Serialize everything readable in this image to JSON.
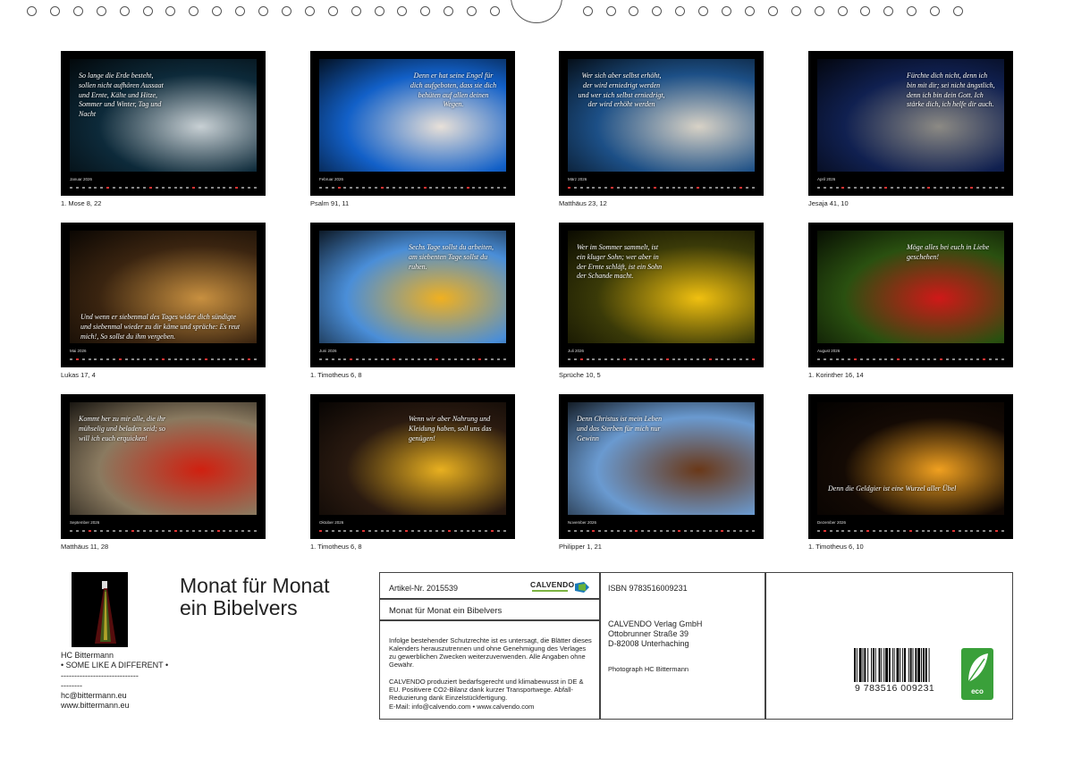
{
  "months": [
    {
      "name": "Januar 2026",
      "caption": "1. Mose 8, 22",
      "verse": "So lange die Erde besteht, sollen nicht aufhören Aussaat und Ernte, Kälte und Hitze, Sommer und Winter, Tag und Nacht",
      "bg": "#0d2a3a",
      "accent": "#c8d0d4"
    },
    {
      "name": "Februar 2026",
      "caption": "Psalm 91, 11",
      "verse": "Denn er hat seine Engel für dich aufgeboten, dass sie dich behüten auf allen deinen Wegen.",
      "bg": "#1260c8",
      "accent": "#e8e0d8"
    },
    {
      "name": "März 2026",
      "caption": "Matthäus 23, 12",
      "verse": "Wer sich aber selbst erhöht, der wird erniedrigt werden und wer sich selbst erniedrigt, der wird erhöht werden",
      "bg": "#1c4f86",
      "accent": "#d8d2c6"
    },
    {
      "name": "April 2026",
      "caption": "Jesaja 41, 10",
      "verse": "Fürchte dich nicht, denn ich bin mit dir; sei nicht ängstlich, denn ich bin dein Gott. Ich stärke dich, ich helfe dir auch.",
      "bg": "#102050",
      "accent": "#8c8a84"
    },
    {
      "name": "Mai 2026",
      "caption": "Lukas 17, 4",
      "verse": "Und wenn er siebenmal des Tages wider dich sündigte und siebenmal wieder zu dir käme und spräche: Es reut mich!, So sollst du ihm vergeben.",
      "bg": "#3a2410",
      "accent": "#c89040"
    },
    {
      "name": "Juni 2026",
      "caption": "1. Timotheus 6, 8",
      "verse": "Sechs Tage sollst du arbeiten, am siebenten Tage sollst du ruhen.",
      "bg": "#4a8ed8",
      "accent": "#f0b020"
    },
    {
      "name": "Juli 2026",
      "caption": "Sprüche 10, 5",
      "verse": "Wer im Sommer sammelt, ist ein kluger Sohn; wer aber in der Ernte schläft, ist ein Sohn der Schande macht.",
      "bg": "#3a3a08",
      "accent": "#f0c010"
    },
    {
      "name": "August 2026",
      "caption": "1. Korinther 16, 14",
      "verse": "Möge alles bei euch in Liebe geschehen!",
      "bg": "#2a5010",
      "accent": "#d01818"
    },
    {
      "name": "September 2026",
      "caption": "Matthäus 11, 28",
      "verse": "Kommt her zu mir alle, die ihr mühselig und beladen seid; so will ich euch erquicken!",
      "bg": "#8a7a60",
      "accent": "#d02010"
    },
    {
      "name": "Oktober 2026",
      "caption": "1. Timotheus 6, 8",
      "verse": "Wenn wir aber Nahrung und Kleidung haben, soll uns das genügen!",
      "bg": "#2a1a10",
      "accent": "#e8b020"
    },
    {
      "name": "November 2026",
      "caption": "Philipper 1, 21",
      "verse": "Denn Christus ist mein Leben und das Sterben für mich nur Gewinn",
      "bg": "#6a9ad0",
      "accent": "#6a3818"
    },
    {
      "name": "Dezember 2026",
      "caption": "1. Timotheus 6, 10",
      "verse": "Denn die Geldgier ist eine Wurzel aller Übel",
      "bg": "#140a04",
      "accent": "#f0a020"
    }
  ],
  "footer": {
    "author_name": "HC Bittermann",
    "author_line2": "• SOME LIKE A DIFFERENT •",
    "author_line3": "-----------------------------",
    "author_line4": "--------",
    "email": "hc@bittermann.eu",
    "website": "www.bittermann.eu",
    "title_line1": "Monat für Monat",
    "title_line2": "ein Bibelvers",
    "article_nr": "Artikel-Nr. 2015539",
    "brand": "CALVENDO",
    "product_title": "Monat für Monat ein Bibelvers",
    "legal1": "Infolge bestehender Schutzrechte ist es untersagt, die Blätter dieses Kalenders herauszutrennen und ohne Genehmigung des Verlages zu gewerblichen Zwecken weiterzuverwenden. Alle Angaben ohne Gewähr.",
    "legal2": "CALVENDO produziert bedarfsgerecht und klimabewusst in DE & EU. Positivere CO2-Bilanz dank kurzer Transportwege. Abfall-Reduzierung dank Einzelstückfertigung.",
    "contact": "E-Mail: info@calvendo.com • www.calvendo.com",
    "isbn": "ISBN 9783516009231",
    "publisher1": "CALVENDO Verlag GmbH",
    "publisher2": "Ottobrunner Straße 39",
    "publisher3": "D-82008 Unterhaching",
    "photographer": "Photograph HC Bittermann",
    "barcode_number": "9 783516 009231",
    "eco_label": "eco"
  }
}
